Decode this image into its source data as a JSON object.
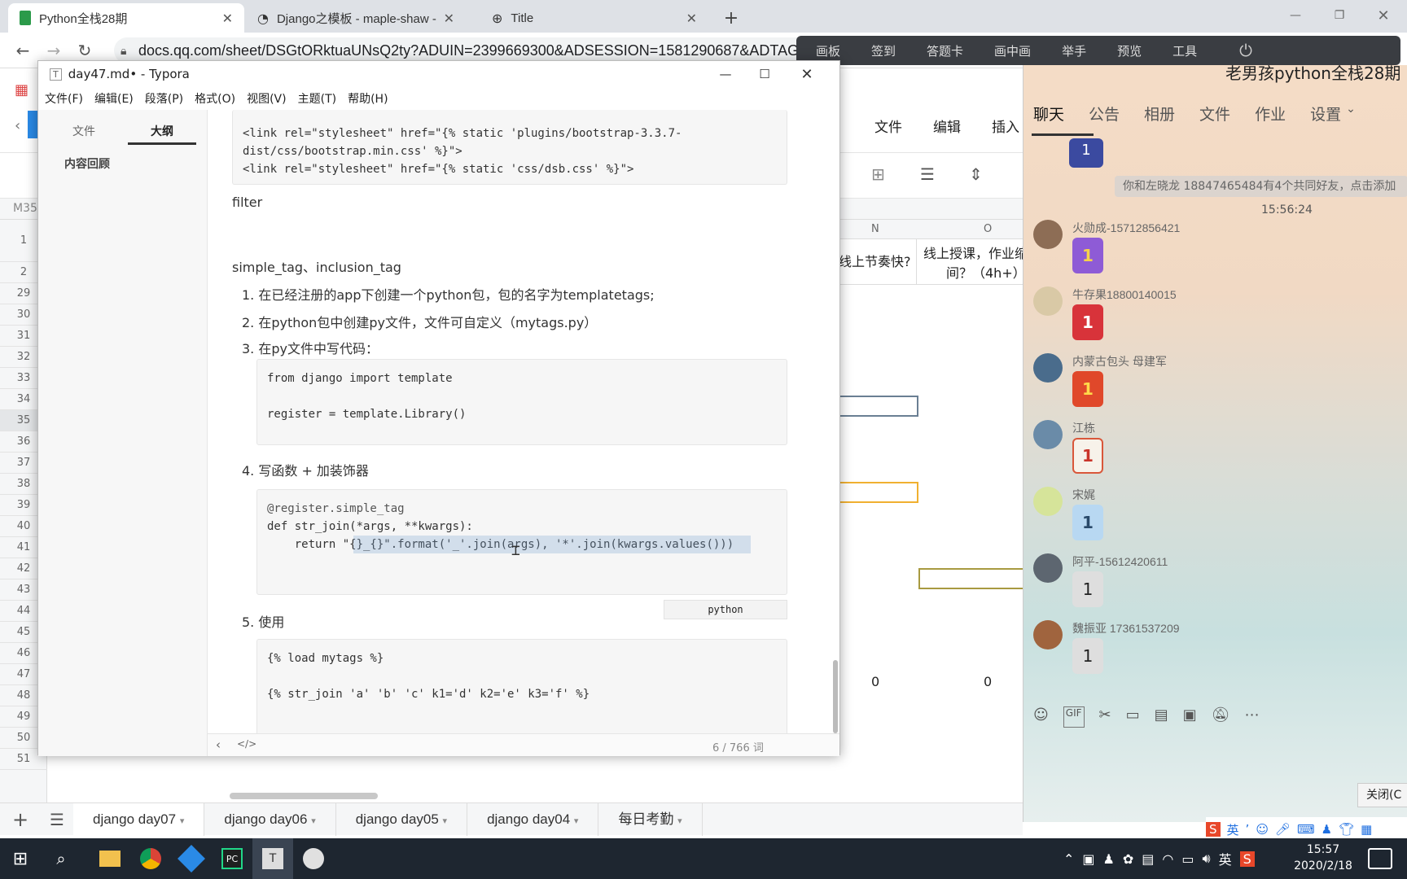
{
  "browser": {
    "tabs": [
      {
        "title": "Python全栈28期"
      },
      {
        "title": "Django之模板 - maple-shaw -"
      },
      {
        "title": "Title"
      }
    ],
    "url": "docs.qq.com/sheet/DSGtORktuaUNsQ2ty?ADUIN=2399669300&ADSESSION=1581290687&ADTAG="
  },
  "meeting_toolbar": [
    "画板",
    "签到",
    "答题卡",
    "画中画",
    "举手",
    "预览",
    "工具"
  ],
  "sheet": {
    "toolbar": [
      "文件",
      "编辑",
      "插入"
    ],
    "cell_ref": "M35",
    "col_n": "N",
    "col_o": "O",
    "header_n": "线上节奏快?",
    "header_o": "线上授课，作业缩",
    "header_o2": "间？（4h+）",
    "row_numbers": [
      "1",
      "2",
      "29",
      "30",
      "31",
      "32",
      "33",
      "34",
      "35",
      "36",
      "37",
      "38",
      "39",
      "40",
      "41",
      "42",
      "43",
      "44",
      "45",
      "46",
      "47",
      "48",
      "49",
      "50",
      "51"
    ],
    "row46_values": [
      "0",
      "0"
    ],
    "tabs": [
      "django day07",
      "django day06",
      "django day05",
      "django day04",
      "每日考勤"
    ]
  },
  "typora": {
    "title": "day47.md• - Typora",
    "menu": [
      "文件(F)",
      "编辑(E)",
      "段落(P)",
      "格式(O)",
      "视图(V)",
      "主题(T)",
      "帮助(H)"
    ],
    "side_tabs": [
      "文件",
      "大纲"
    ],
    "outline": [
      "内容回顾"
    ],
    "code1": [
      "<link rel=\"stylesheet\" href=\"{% static 'plugins/bootstrap-3.3.7-",
      "dist/css/bootstrap.min.css' %}\">",
      "<link rel=\"stylesheet\" href=\"{% static 'css/dsb.css' %}\">"
    ],
    "filter": "filter",
    "heading": "simple_tag、inclusion_tag",
    "steps": [
      "1. 在已经注册的app下创建一个python包，包的名字为templatetags;",
      "2. 在python包中创建py文件，文件可自定义（mytags.py）",
      "3. 在py文件中写代码："
    ],
    "code2": [
      "from django import template",
      "",
      "register = template.Library()"
    ],
    "step4": "4. 写函数 + 加装饰器",
    "code3": [
      "@register.simple_tag",
      "def str_join(*args, **kwargs):",
      "    return \"{}_{}\".format('_'.join(args), '*'.join(kwargs.values()))"
    ],
    "code_lang": "python",
    "step5": "5. 使用",
    "code4": [
      "{% load mytags %}",
      "",
      "{% str_join 'a' 'b' 'c' k1='d' k2='e' k3='f' %}"
    ],
    "word_count": "6 / 766 词"
  },
  "chat": {
    "group_name": "老男孩python全栈28期",
    "tabs": [
      "聊天",
      "公告",
      "相册",
      "文件",
      "作业",
      "设置"
    ],
    "notice": "你和左晓龙   18847465484有4个共同好友，点击添加",
    "time": "15:56:24",
    "messages": [
      {
        "name": "火勋成-15712856421",
        "text": "1",
        "color": "#8e5bd6"
      },
      {
        "name": "牛存果18800140015",
        "text": "1",
        "color": "#d8333a"
      },
      {
        "name": "内蒙古包头  母建军",
        "text": "1",
        "color": "#e0482a"
      },
      {
        "name": "江栋",
        "text": "1",
        "color": "#f2f2f2"
      },
      {
        "name": "宋娓",
        "text": "1",
        "color": "#b8d8f2"
      },
      {
        "name": "阿平-15612420611",
        "text": "1",
        "color": "#e6e6e6"
      },
      {
        "name": "魏振亚 17361537209",
        "text": "1",
        "color": "#e6e6e6"
      }
    ],
    "close_label": "关闭(C"
  },
  "taskbar": {
    "ime": "英",
    "time": "15:57",
    "date": "2020/2/18"
  }
}
